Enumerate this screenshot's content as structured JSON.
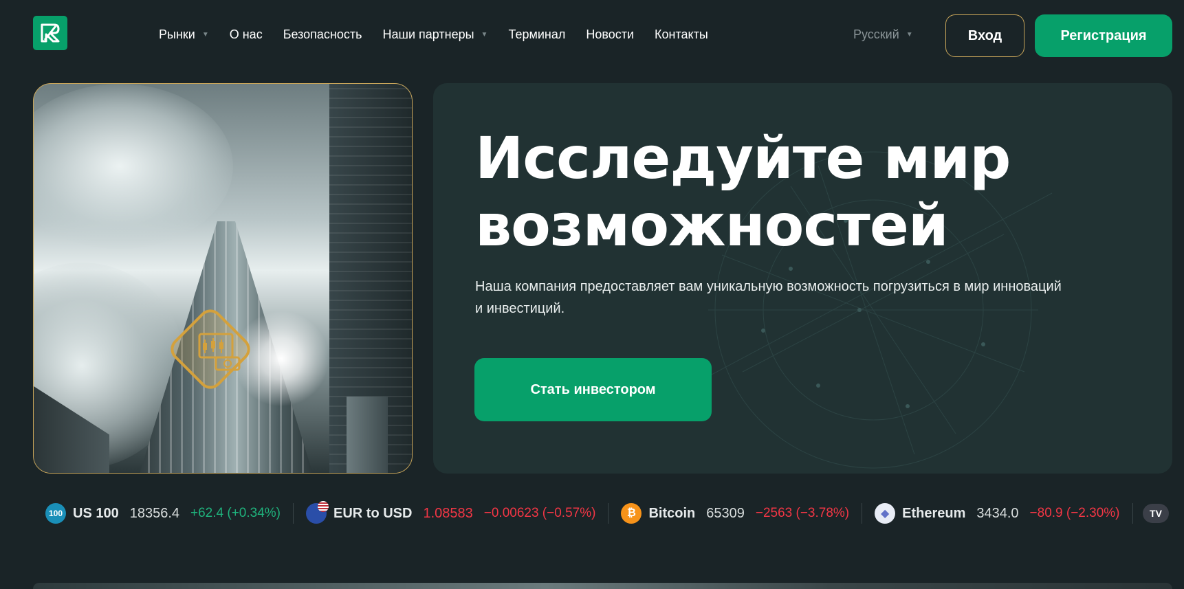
{
  "header": {
    "logo_icon": "brand-logo-icon",
    "nav": [
      {
        "label": "Рынки",
        "has_dropdown": true
      },
      {
        "label": "О нас",
        "has_dropdown": false
      },
      {
        "label": "Безопасность",
        "has_dropdown": false
      },
      {
        "label": "Наши партнеры",
        "has_dropdown": true
      },
      {
        "label": "Терминал",
        "has_dropdown": false
      },
      {
        "label": "Новости",
        "has_dropdown": false
      },
      {
        "label": "Контакты",
        "has_dropdown": false
      }
    ],
    "language": "Русский",
    "login_label": "Вход",
    "register_label": "Регистрация"
  },
  "hero": {
    "title": "Исследуйте мир возможностей",
    "description": "Наша компания предоставляет вам уникальную возможность погрузиться в мир инноваций и инвестиций.",
    "cta_label": "Стать инвестором"
  },
  "ticker": [
    {
      "icon": "100",
      "icon_color": "#1a8fb8",
      "name": "US 100",
      "price": "18356.4",
      "change": "+62.4 (+0.34%)",
      "direction": "up"
    },
    {
      "icon": "eu-us-flag",
      "icon_color": "#2a4ea8",
      "name": "EUR to USD",
      "price": "1.08583",
      "change": "−0.00623 (−0.57%)",
      "direction": "down"
    },
    {
      "icon": "₿",
      "icon_color": "#f7931a",
      "name": "Bitcoin",
      "price": "65309",
      "change": "−2563 (−3.78%)",
      "direction": "down"
    },
    {
      "icon": "◆",
      "icon_color": "#e8ecf5",
      "name": "Ethereum",
      "price": "3434.0",
      "change": "−80.9 (−2.30%)",
      "direction": "down"
    }
  ],
  "colors": {
    "accent": "#07a06a",
    "gold": "#c9a65a",
    "background": "#1a2427",
    "card": "#213233",
    "up": "#1fb27c",
    "down": "#f23645"
  }
}
